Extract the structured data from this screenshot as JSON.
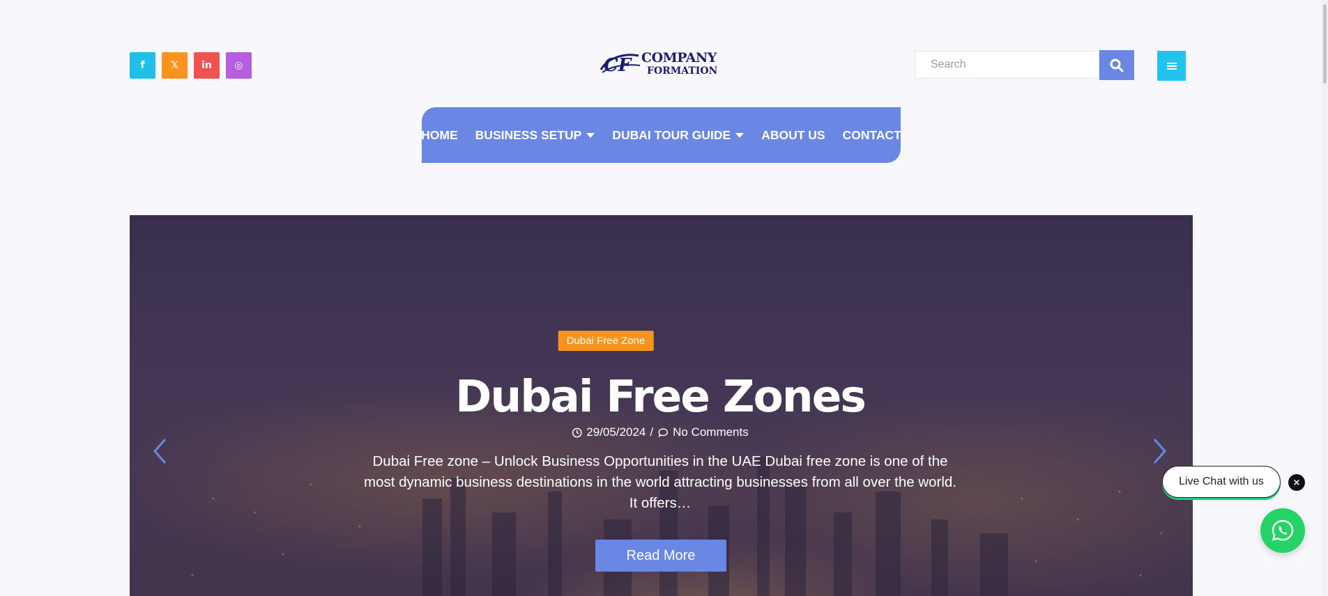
{
  "social": {
    "facebook": {
      "icon": "facebook-icon",
      "glyph": "f",
      "color": "#1fbfe8"
    },
    "x": {
      "icon": "x-icon",
      "glyph": "𝕏",
      "color": "#f7931e"
    },
    "linkedin": {
      "icon": "linkedin-icon",
      "glyph": "in",
      "color": "#ef5350"
    },
    "instagram": {
      "icon": "instagram-icon",
      "glyph": "◎",
      "color": "#b55ee0"
    }
  },
  "logo": {
    "line1": "COMPANY",
    "line2": "FORMATION",
    "mark": "CF"
  },
  "search": {
    "placeholder": "Search",
    "value": ""
  },
  "nav": {
    "items": [
      {
        "label": "HOME"
      },
      {
        "label": "BUSINESS SETUP"
      },
      {
        "label": "DUBAI TOUR GUIDE"
      },
      {
        "label": "ABOUT US"
      },
      {
        "label": "CONTACT"
      }
    ]
  },
  "hero": {
    "category": "Dubai Free Zone",
    "title": "Dubai Free Zones",
    "date": "29/05/2024",
    "separator": "/",
    "comments": "No Comments",
    "excerpt": "Dubai Free zone – Unlock Business Opportunities in the UAE Dubai free zone is one of the most dynamic business destinations in the world attracting businesses from all over the world. It offers…",
    "button": "Read More"
  },
  "chat": {
    "label": "Live Chat with us",
    "close": "×"
  },
  "colors": {
    "accent": "#6a87e4",
    "badge": "#f7941d",
    "whatsapp": "#25d366",
    "menu": "#21c4ef"
  }
}
